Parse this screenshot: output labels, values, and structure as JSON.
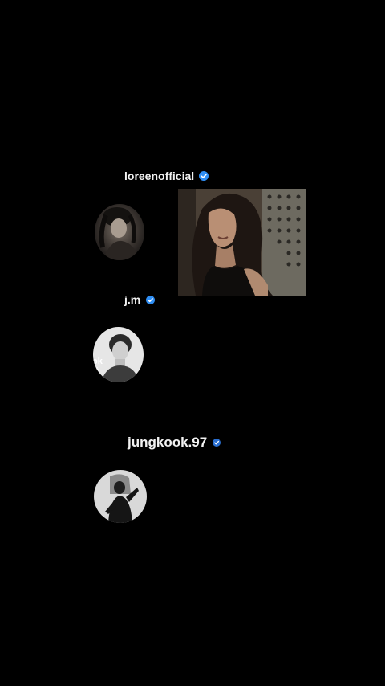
{
  "accounts": [
    {
      "username": "loreenofficial",
      "verified": true,
      "avatar_icon": "profile-photo"
    },
    {
      "username": "j.m",
      "verified": true,
      "avatar_icon": "profile-photo",
      "avatar_overlay_text": "ok\nok"
    },
    {
      "username": "jungkook.97",
      "verified": true,
      "avatar_icon": "profile-photo"
    }
  ],
  "colors": {
    "background": "#000000",
    "username_text": "#f2f2f2",
    "verified_badge": "#2f8ef4"
  }
}
